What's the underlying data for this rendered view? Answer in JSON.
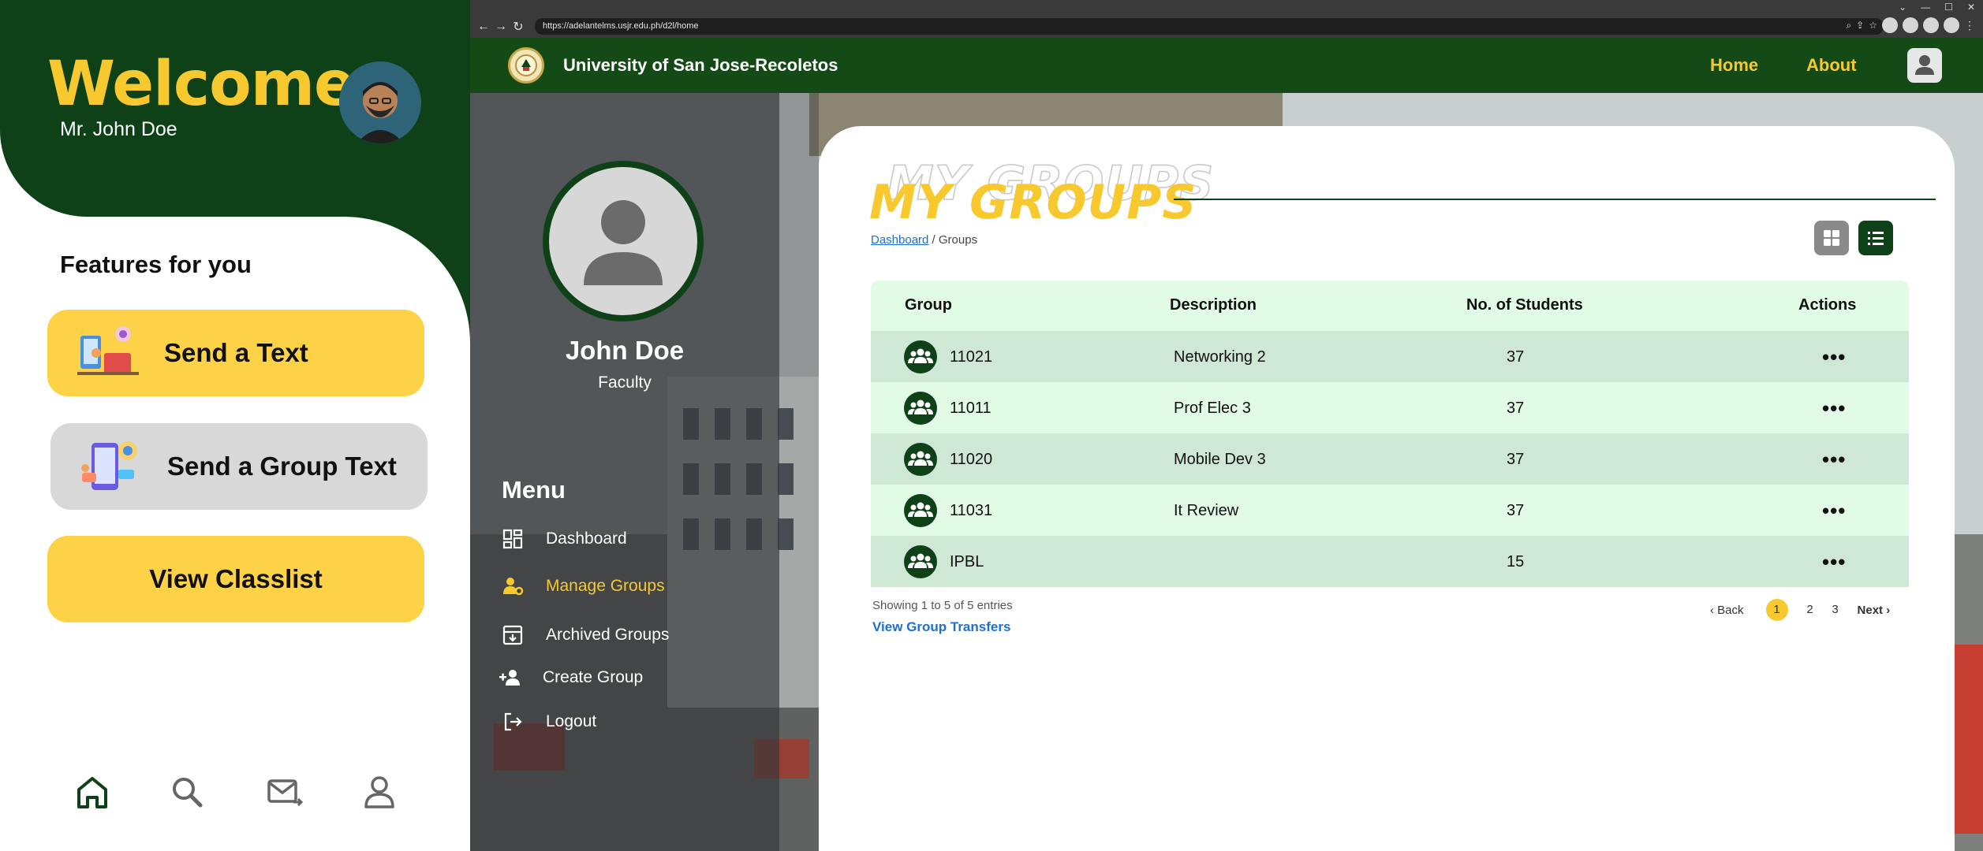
{
  "mobile": {
    "welcome": "Welcome",
    "user_greeting": "Mr. John Doe",
    "features_title": "Features for you",
    "features": [
      {
        "label": "Send a Text"
      },
      {
        "label": "Send a Group Text"
      },
      {
        "label": "View Classlist"
      }
    ],
    "bottom_nav": [
      "home-icon",
      "search-icon",
      "mail-icon",
      "profile-icon"
    ],
    "colors": {
      "brand_green": "#0f4119",
      "accent_yellow": "#fdd246"
    }
  },
  "browser": {
    "url": "https://adelantelms.usjr.edu.ph/d2l/home"
  },
  "site": {
    "university": "University of San Jose-Recoletos",
    "nav": {
      "home": "Home",
      "about": "About"
    }
  },
  "sidebar": {
    "name": "John Doe",
    "role": "Faculty",
    "menu_title": "Menu",
    "items": [
      {
        "label": "Dashboard"
      },
      {
        "label": "Manage Groups"
      },
      {
        "label": "Archived Groups"
      },
      {
        "label": "Create Group"
      },
      {
        "label": "Logout"
      }
    ]
  },
  "main": {
    "title": "MY GROUPS",
    "breadcrumb_link": "Dashboard",
    "breadcrumb_current": " / Groups",
    "table": {
      "headers": {
        "group": "Group",
        "description": "Description",
        "students": "No. of Students",
        "actions": "Actions"
      },
      "rows": [
        {
          "group": "11021",
          "description": "Networking 2",
          "students": "37",
          "actions": "•••"
        },
        {
          "group": "11011",
          "description": "Prof Elec 3",
          "students": "37",
          "actions": "•••"
        },
        {
          "group": "11020",
          "description": "Mobile Dev 3",
          "students": "37",
          "actions": "•••"
        },
        {
          "group": "11031",
          "description": "It Review",
          "students": "37",
          "actions": "•••"
        },
        {
          "group": "IPBL",
          "description": "",
          "students": "15",
          "actions": "•••"
        }
      ]
    },
    "showing": "Showing 1 to 5 of 5 entries",
    "view_transfers": "View Group Transfers",
    "pager": {
      "back": "‹ Back",
      "pages": [
        "1",
        "2",
        "3"
      ],
      "next": "Next ›"
    }
  }
}
